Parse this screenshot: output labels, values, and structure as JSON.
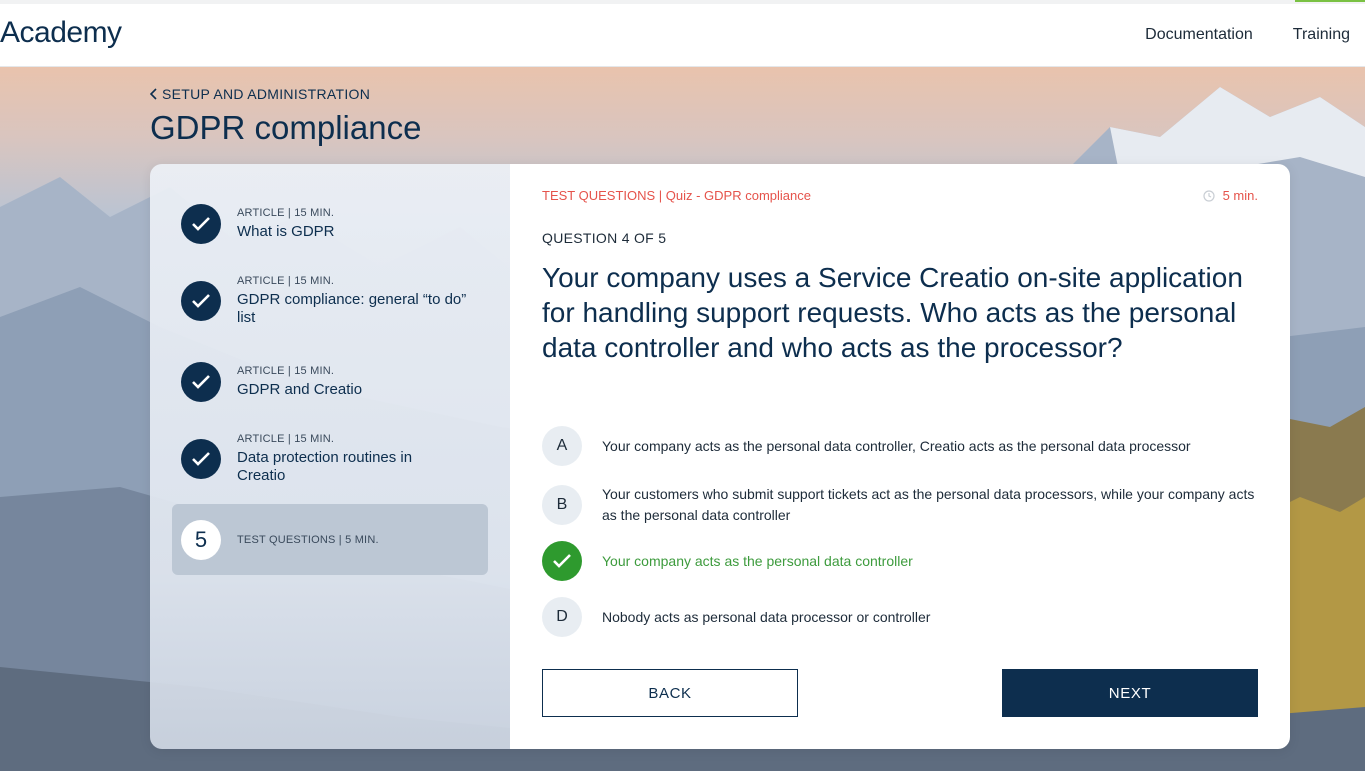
{
  "header": {
    "logo": "Academy",
    "nav": [
      "Documentation",
      "Training"
    ]
  },
  "page": {
    "breadcrumb": "SETUP AND ADMINISTRATION",
    "title": "GDPR compliance"
  },
  "steps": [
    {
      "meta": "ARTICLE | 15 MIN.",
      "title": "What is GDPR",
      "status": "done"
    },
    {
      "meta": "ARTICLE | 15 MIN.",
      "title": "GDPR compliance: general “to do” list",
      "status": "done"
    },
    {
      "meta": "ARTICLE | 15 MIN.",
      "title": "GDPR and Creatio",
      "status": "done"
    },
    {
      "meta": "ARTICLE | 15 MIN.",
      "title": "Data protection routines in Creatio",
      "status": "done"
    },
    {
      "number": "5",
      "meta": "TEST QUESTIONS | 5 MIN.",
      "status": "active"
    }
  ],
  "quiz": {
    "section": "TEST QUESTIONS | Quiz - GDPR compliance",
    "time": "5 min.",
    "question_count": "QUESTION 4 OF 5",
    "question": "Your company uses a Service Creatio on-site application for handling support requests. Who acts as the personal data controller and who acts as the processor?",
    "answers": [
      {
        "letter": "A",
        "text": "Your company acts as the personal data controller, Creatio acts as the personal data processor",
        "correct": false
      },
      {
        "letter": "B",
        "text": "Your customers who submit support tickets act as the personal data processors, while your company acts as the personal data controller",
        "correct": false
      },
      {
        "letter": "C",
        "text": "Your company acts as the personal data controller",
        "correct": true
      },
      {
        "letter": "D",
        "text": "Nobody acts as personal data processor or controller",
        "correct": false
      }
    ],
    "back_label": "BACK",
    "next_label": "NEXT"
  },
  "colors": {
    "brand_navy": "#0d2e4e",
    "accent_red": "#e5534b",
    "correct_green": "#2e9a2e"
  },
  "icons": [
    "chevron-left-icon",
    "checkmark-icon",
    "clock-icon"
  ]
}
